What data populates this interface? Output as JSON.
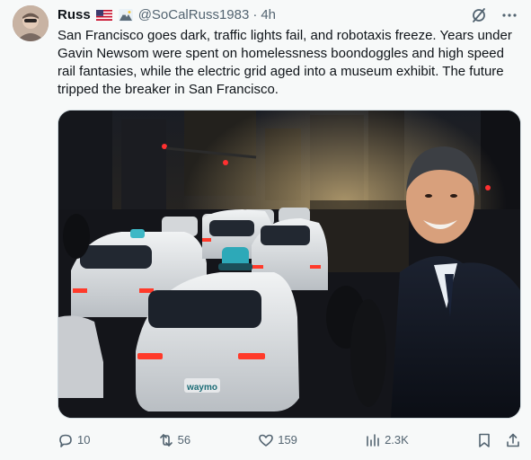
{
  "author": {
    "name": "Russ",
    "handle": "@SoCalRuss1983",
    "separator": "·",
    "time": "4h",
    "flag_icon": "us-flag-icon",
    "emoji_icon": "mountain-icon"
  },
  "tweet": {
    "text": "San Francisco goes dark, traffic lights fail, and robotaxis freeze. Years under Gavin Newsom were spent on homelessness boondoggles and high speed rail fantasies, while the electric grid aged into a museum exhibit. The future tripped the breaker in San Francisco."
  },
  "media": {
    "car_logo_text": "waymo"
  },
  "actions": {
    "replies": "10",
    "reposts": "56",
    "likes": "159",
    "views": "2.3K"
  },
  "colors": {
    "text_primary": "#0f1419",
    "text_secondary": "#536471",
    "background": "#f7f9f9",
    "border": "#cfd9de"
  }
}
